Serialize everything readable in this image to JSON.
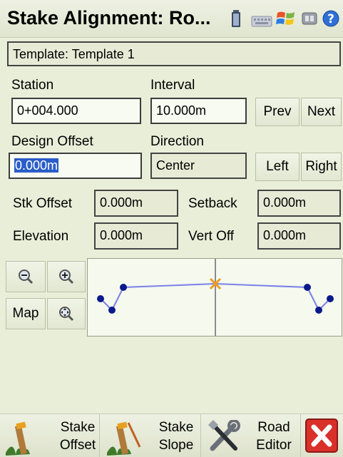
{
  "title": "Stake Alignment: Ro...",
  "tray_icons": [
    "battery-icon",
    "keyboard-icon",
    "windows-flag-icon",
    "connection-icon",
    "help-icon"
  ],
  "template": "Template: Template 1",
  "station": {
    "label": "Station",
    "value": "0+004.000"
  },
  "interval": {
    "label": "Interval",
    "value": "10.000m"
  },
  "prev_label": "Prev",
  "next_label": "Next",
  "design_offset": {
    "label": "Design Offset",
    "value": "0.000m"
  },
  "direction": {
    "label": "Direction",
    "value": "Center"
  },
  "left_label": "Left",
  "right_label": "Right",
  "stk_offset": {
    "label": "Stk Offset",
    "value": "0.000m"
  },
  "setback": {
    "label": "Setback",
    "value": "0.000m"
  },
  "elevation": {
    "label": "Elevation",
    "value": "0.000m"
  },
  "vert_off": {
    "label": "Vert Off",
    "value": "0.000m"
  },
  "zoom_out_icon": "zoom-out-icon",
  "zoom_in_icon": "zoom-in-icon",
  "map_label": "Map",
  "zoom_extents_icon": "zoom-extents-icon",
  "bottom": {
    "stake_offset": [
      "Stake",
      "Offset"
    ],
    "stake_slope": [
      "Stake",
      "Slope"
    ],
    "road_editor": [
      "Road",
      "Editor"
    ]
  },
  "colors": {
    "selection": "#2a5dc8",
    "profile_line": "#7b80e8",
    "profile_point": "#0a1a8c",
    "current_point": "#f29b1c",
    "close_button": "#d9302a"
  }
}
